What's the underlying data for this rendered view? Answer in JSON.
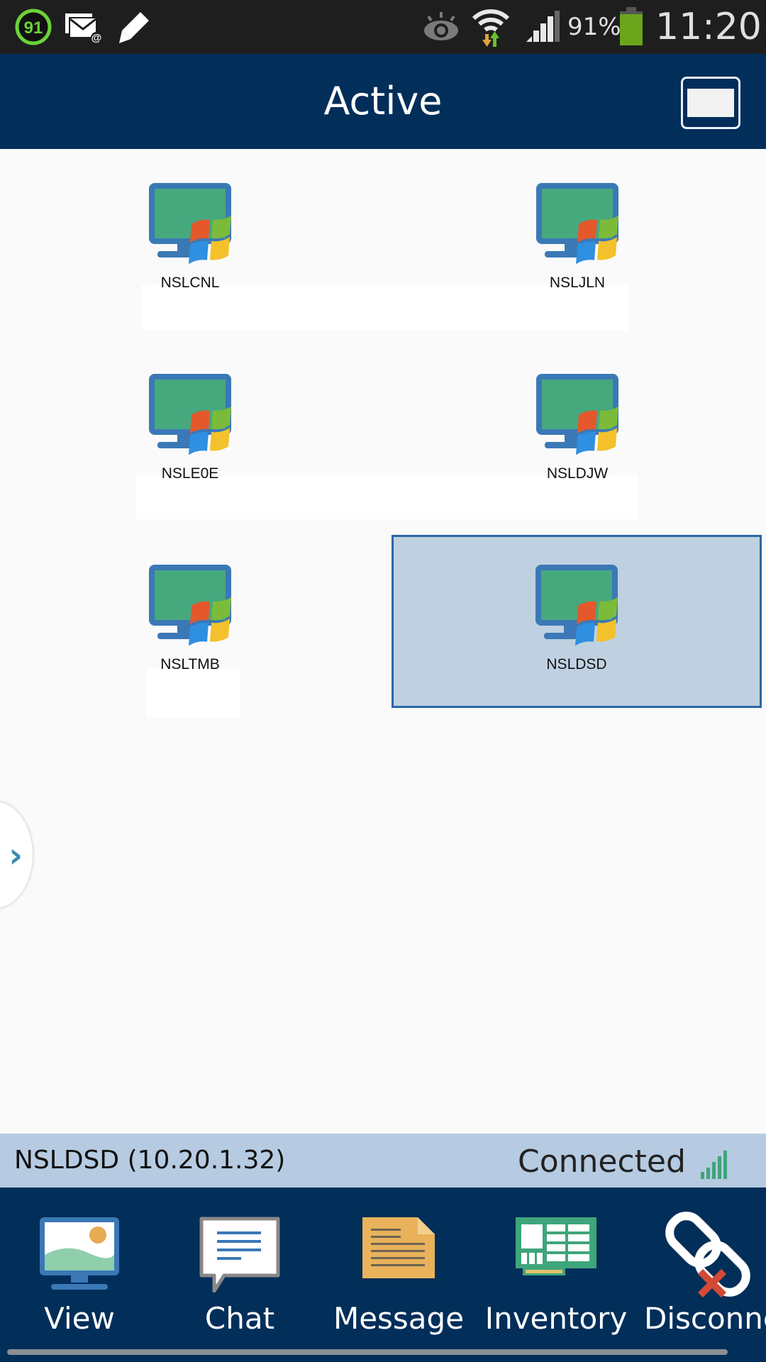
{
  "status_bar": {
    "notification_badge": "91",
    "battery_percent": "91%",
    "battery_level": 0.91,
    "time": "11:20",
    "icons": [
      "counter-badge-icon",
      "email-icon",
      "pencil-icon",
      "eye-icon",
      "wifi-icon",
      "cell-signal-icon",
      "battery-icon"
    ]
  },
  "header": {
    "title": "Active",
    "window_button_icon": "window-icon"
  },
  "computers": [
    {
      "name": "NSLCNL",
      "icon": "windows-pc-icon",
      "selected": false
    },
    {
      "name": "NSLJLN",
      "icon": "windows-pc-icon",
      "selected": false
    },
    {
      "name": "NSLE0E",
      "icon": "windows-pc-icon",
      "selected": false
    },
    {
      "name": "NSLDJW",
      "icon": "windows-pc-icon",
      "selected": false
    },
    {
      "name": "NSLTMB",
      "icon": "windows-pc-icon",
      "selected": false
    },
    {
      "name": "NSLDSD",
      "icon": "windows-pc-icon",
      "selected": true
    }
  ],
  "side_handle": {
    "icon": "chevron-right-icon"
  },
  "connection": {
    "name": "NSLDSD",
    "ip": "(10.20.1.32)",
    "status": "Connected",
    "signal_icon": "signal-strength-icon"
  },
  "toolbar": {
    "items": [
      {
        "label": "View",
        "icon": "view-screen-icon"
      },
      {
        "label": "Chat",
        "icon": "chat-bubble-icon"
      },
      {
        "label": "Message",
        "icon": "message-document-icon"
      },
      {
        "label": "Inventory",
        "icon": "inventory-card-icon"
      },
      {
        "label": "Disconnect",
        "icon": "disconnect-link-icon"
      }
    ]
  },
  "colors": {
    "header_bg": "#022e5a",
    "status_bar_bg": "#1e1e1e",
    "selection_bg": "#bfd1e1",
    "selection_border": "#2c67a4",
    "connection_bar_bg": "#b6cbe1",
    "signal_green": "#3fa57a",
    "battery_green": "#6aa51c"
  }
}
